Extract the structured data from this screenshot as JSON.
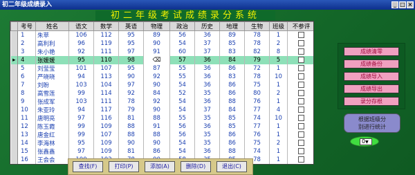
{
  "window": {
    "title": "初二年级成绩录入",
    "buttons": [
      "_",
      "□",
      "×"
    ]
  },
  "system_title": "初二年级考试成绩录分系统",
  "grid": {
    "columns": [
      "考号",
      "姓名",
      "语文",
      "数学",
      "英语",
      "物理",
      "政治",
      "历史",
      "地理",
      "生物",
      "班级",
      "不参评"
    ],
    "rows": [
      [
        "1",
        "朱苹",
        "106",
        "112",
        "95",
        "89",
        "56",
        "36",
        "89",
        "78",
        "1",
        ""
      ],
      [
        "2",
        "高利利",
        "96",
        "119",
        "95",
        "90",
        "54",
        "37",
        "85",
        "78",
        "2",
        ""
      ],
      [
        "3",
        "朱小艳",
        "92",
        "111",
        "97",
        "91",
        "60",
        "37",
        "83",
        "82",
        "8",
        ""
      ],
      [
        "4",
        "张媛媛",
        "95",
        "110",
        "98",
        "⌫",
        "57",
        "36",
        "84",
        "79",
        "5",
        ""
      ],
      [
        "5",
        "刘莹莹",
        "101",
        "107",
        "95",
        "87",
        "55",
        "36",
        "86",
        "72",
        "1",
        ""
      ],
      [
        "6",
        "严晓晓",
        "94",
        "113",
        "90",
        "92",
        "55",
        "36",
        "83",
        "78",
        "10",
        ""
      ],
      [
        "7",
        "刘盼",
        "103",
        "104",
        "97",
        "90",
        "54",
        "36",
        "86",
        "75",
        "1",
        ""
      ],
      [
        "8",
        "高雪莲",
        "99",
        "114",
        "92",
        "84",
        "52",
        "35",
        "86",
        "80",
        "2",
        ""
      ],
      [
        "9",
        "张成军",
        "103",
        "111",
        "78",
        "92",
        "54",
        "36",
        "88",
        "76",
        "1",
        ""
      ],
      [
        "10",
        "朱亚玲",
        "94",
        "117",
        "79",
        "90",
        "54",
        "37",
        "84",
        "77",
        "4",
        ""
      ],
      [
        "11",
        "唐明亮",
        "97",
        "116",
        "81",
        "88",
        "55",
        "35",
        "85",
        "74",
        "10",
        ""
      ],
      [
        "12",
        "陈玉霞",
        "99",
        "109",
        "88",
        "91",
        "56",
        "36",
        "85",
        "77",
        "1",
        ""
      ],
      [
        "13",
        "唐金红",
        "99",
        "107",
        "88",
        "88",
        "56",
        "35",
        "86",
        "76",
        "1",
        ""
      ],
      [
        "14",
        "李海林",
        "95",
        "109",
        "90",
        "90",
        "54",
        "35",
        "86",
        "75",
        "2",
        ""
      ],
      [
        "15",
        "张鑫鑫",
        "97",
        "109",
        "81",
        "86",
        "54",
        "36",
        "88",
        "74",
        "1",
        ""
      ],
      [
        "16",
        "王会会",
        "100",
        "102",
        "78",
        "90",
        "58",
        "35",
        "85",
        "78",
        "1",
        ""
      ]
    ],
    "selected_row_index": 3,
    "current_row_marker": "▸",
    "new_row_marker": "*"
  },
  "right_buttons": [
    "成绩清零",
    "成绩备份",
    "成绩导入",
    "成绩导出",
    "录分存根"
  ],
  "note": {
    "line1": "根据班级分",
    "line2": "别进行统计"
  },
  "class_select": {
    "value": "0"
  },
  "bottom_buttons": [
    "查找(F)",
    "打印(P)",
    "添加(A)",
    "删除(D)",
    "退出(C)"
  ]
}
